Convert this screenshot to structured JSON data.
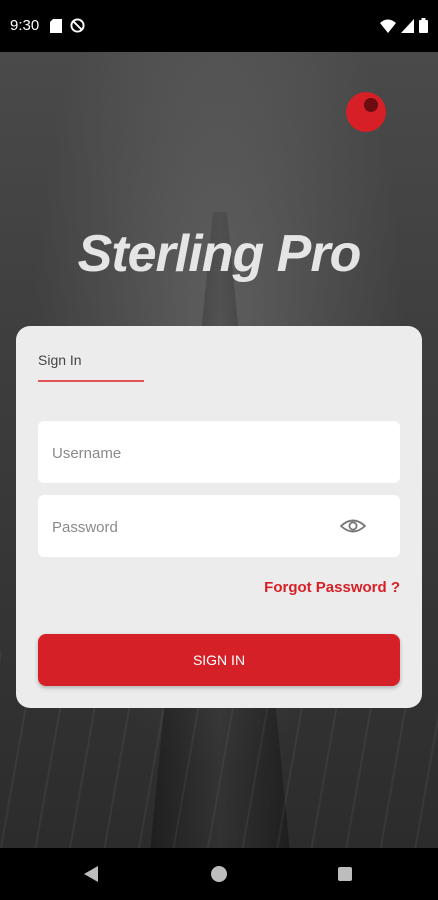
{
  "status_bar": {
    "time": "9:30",
    "icons": [
      "sd-card-icon",
      "do-not-disturb-icon",
      "wifi-icon",
      "signal-icon",
      "battery-icon"
    ]
  },
  "brand": {
    "app_title": "Sterling Pro",
    "accent_color": "#d61f26"
  },
  "login": {
    "tab_label": "Sign In",
    "username_placeholder": "Username",
    "password_placeholder": "Password",
    "forgot_label": "Forgot Password ?",
    "submit_label": "SIGN IN"
  },
  "nav_bar": {
    "icons": [
      "back-icon",
      "home-icon",
      "recents-icon"
    ]
  }
}
